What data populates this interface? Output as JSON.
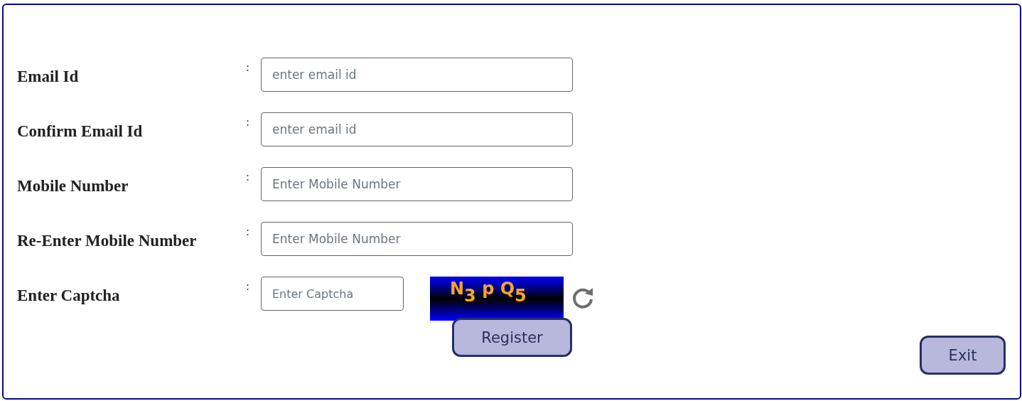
{
  "fields": [
    {
      "kind": "text",
      "label": "Email Id",
      "separator": ":",
      "placeholder": "enter email id"
    },
    {
      "kind": "text",
      "label": "Confirm Email Id",
      "separator": ":",
      "placeholder": "enter email id"
    },
    {
      "kind": "text",
      "label": "Mobile Number",
      "separator": ":",
      "placeholder": "Enter Mobile Number"
    },
    {
      "kind": "text",
      "label": "Re-Enter Mobile Number",
      "separator": ":",
      "placeholder": "Enter Mobile Number"
    },
    {
      "kind": "captcha",
      "label": "Enter Captcha",
      "separator": ":",
      "placeholder": "Enter Captcha",
      "captcha": "N$_{3}$ p Q$_{5}$"
    }
  ],
  "buttons": {
    "register": "Register",
    "exit": "Exit"
  }
}
